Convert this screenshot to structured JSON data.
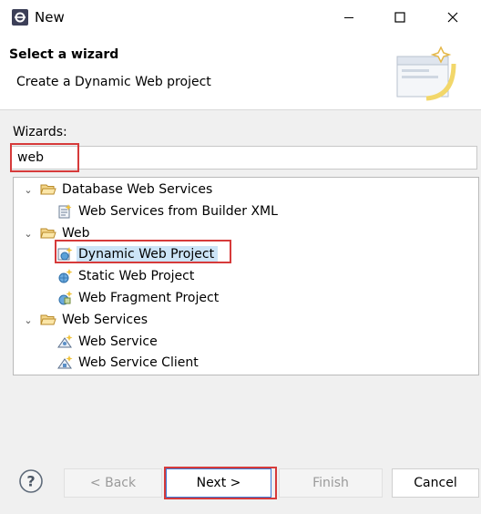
{
  "window": {
    "title": "New"
  },
  "window_controls": {
    "minimize": "minimize-icon",
    "maximize": "maximize-icon",
    "close": "close-icon"
  },
  "banner": {
    "title": "Select a wizard",
    "description": "Create a Dynamic Web project",
    "graphic": "wizard-banner-graphic"
  },
  "filter": {
    "label": "Wizards:",
    "value": "web"
  },
  "tree": {
    "items": [
      {
        "label": "Database Web Services",
        "type": "category",
        "expanded": true,
        "icon": "folder-open-icon"
      },
      {
        "label": "Web Services from Builder XML",
        "type": "wizard",
        "icon": "web-services-icon"
      },
      {
        "label": "Web",
        "type": "category",
        "expanded": true,
        "icon": "folder-open-icon"
      },
      {
        "label": "Dynamic Web Project",
        "type": "wizard",
        "selected": true,
        "icon": "dynamic-web-project-icon"
      },
      {
        "label": "Static Web Project",
        "type": "wizard",
        "icon": "static-web-project-icon"
      },
      {
        "label": "Web Fragment Project",
        "type": "wizard",
        "icon": "web-fragment-project-icon"
      },
      {
        "label": "Web Services",
        "type": "category",
        "expanded": true,
        "icon": "folder-open-icon"
      },
      {
        "label": "Web Service",
        "type": "wizard",
        "icon": "web-service-icon"
      },
      {
        "label": "Web Service Client",
        "type": "wizard",
        "icon": "web-service-client-icon"
      }
    ]
  },
  "buttons": {
    "help": "help-icon",
    "back": "< Back",
    "next": "Next >",
    "finish": "Finish",
    "cancel": "Cancel"
  },
  "colors": {
    "highlight_box": "#d63a3a",
    "selection": "#cce4f7",
    "default_button_border": "#3b78d4"
  }
}
